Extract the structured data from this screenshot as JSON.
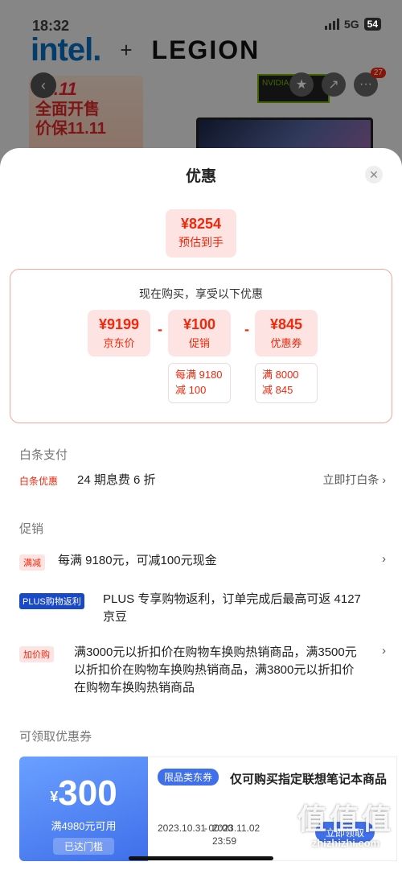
{
  "status": {
    "time": "18:32",
    "network": "5G",
    "battery": "54"
  },
  "background": {
    "brand1": "intel.",
    "plus": "+",
    "brand2": "LEGION",
    "promo_top": "11.11",
    "promo_line1": "全面开售",
    "promo_line2": "价保11.11",
    "nvidia_text": "NVIDIA RTX",
    "cart_badge": "27"
  },
  "sheet": {
    "title": "优惠",
    "final_price": "¥8254",
    "final_label": "预估到手",
    "breakdown_title": "现在购买，享受以下优惠",
    "prices": [
      {
        "value": "¥9199",
        "label": "京东价"
      },
      {
        "value": "¥100",
        "label": "促销"
      },
      {
        "value": "¥845",
        "label": "优惠券"
      }
    ],
    "minus": "-",
    "details": [
      {
        "line1": "每满 9180",
        "line2": "减 100"
      },
      {
        "line1": "满 8000",
        "line2": "减 845"
      }
    ]
  },
  "baitiao": {
    "header": "白条支付",
    "tag": "白条优惠",
    "text": "24 期息费 6 折",
    "action": "立即打白条 ›"
  },
  "promotion": {
    "header": "促销",
    "items": [
      {
        "tag": "满减",
        "text": "每满 9180元，可减100元现金",
        "chevron": "›"
      },
      {
        "tag": "PLUS购物返利",
        "text": "PLUS 专享购物返利，订单完成后最高可返 4127京豆"
      },
      {
        "tag": "加价购",
        "text": "满3000元以折扣价在购物车换购热销商品，满3500元以折扣价在购物车换购热销商品，满3800元以折扣价在购物车换购热销商品",
        "chevron": "›"
      }
    ]
  },
  "coupons": {
    "header": "可领取优惠券",
    "items": [
      {
        "yen": "¥",
        "amount": "300",
        "condition": "满4980元可用",
        "status": "已达门槛",
        "category": "限品类东券",
        "description": "仅可购买指定联想笔记本商品",
        "start": "2023.10.31 00:00",
        "sep": "-",
        "end": "2023.11.02 23:59",
        "button": "立即领取"
      }
    ]
  },
  "watermark": {
    "big": "值值值",
    "small": "zhizhizhi.com"
  },
  "colors": {
    "accent": "#f2270c",
    "coupon_blue": "#3f6fea",
    "plus_blue": "#1a49c8"
  }
}
